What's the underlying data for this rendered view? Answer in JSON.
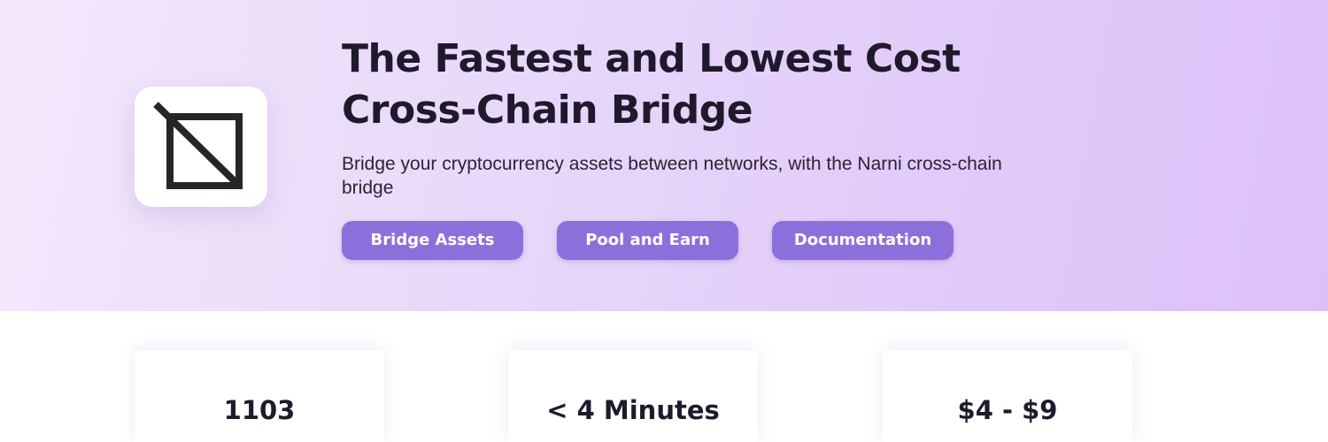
{
  "hero": {
    "logo_icon": "crossed-square-logo-icon",
    "headline": "The Fastest and Lowest Cost Cross-Chain Bridge",
    "subtitle": "Bridge your cryptocurrency assets between networks, with the Narni cross-chain bridge",
    "buttons": {
      "bridge_assets": "Bridge Assets",
      "pool_and_earn": "Pool and Earn",
      "documentation": "Documentation"
    }
  },
  "stats": [
    {
      "value": "1103"
    },
    {
      "value": "< 4 Minutes"
    },
    {
      "value": "$4 - $9"
    }
  ],
  "colors": {
    "accent": "#8d6fdb",
    "hero_gradient_start": "#f3e8fb",
    "hero_gradient_end": "#dcc1f9",
    "text_dark": "#1f1a2b"
  }
}
